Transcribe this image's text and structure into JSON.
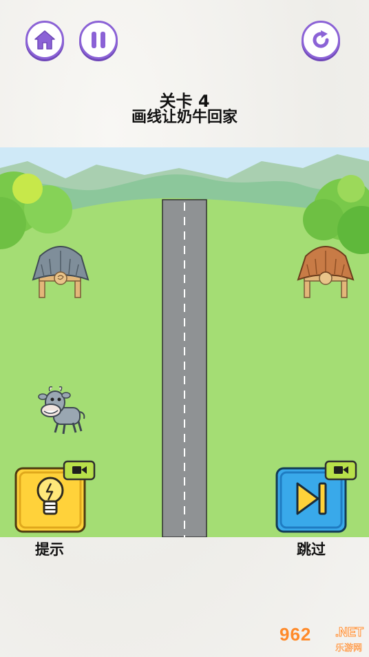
{
  "toolbar": {
    "home_icon": "home-icon",
    "pause_icon": "pause-icon",
    "restart_icon": "restart-icon"
  },
  "level": {
    "title": "关卡 4",
    "instruction": "画线让奶牛回家"
  },
  "scene": {
    "sky_color": "#cfe9f7",
    "grass_color": "#a4dd74",
    "road_color": "#8f9294"
  },
  "actions": {
    "hint_label": "提示",
    "skip_label": "跳过",
    "hint_icon": "lightbulb-icon",
    "skip_icon": "skip-forward-icon",
    "video_badge_icon": "video-ad-icon"
  },
  "watermark": {
    "number": "962",
    "site": ".NET",
    "sub": "乐游网"
  },
  "colors": {
    "button_purple": "#8b62d6",
    "hint_yellow": "#ffd23a",
    "skip_blue": "#39a9ea"
  }
}
